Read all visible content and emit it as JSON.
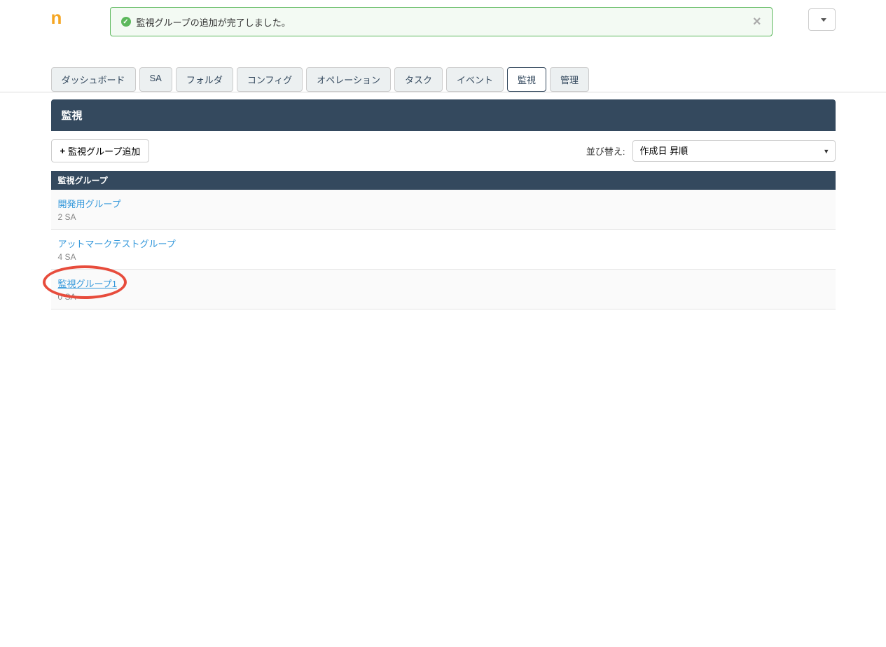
{
  "logo": "n",
  "alert": {
    "message": "監視グループの追加が完了しました。"
  },
  "tabs": [
    {
      "label": "ダッシュボード",
      "active": false
    },
    {
      "label": "SA",
      "active": false
    },
    {
      "label": "フォルダ",
      "active": false
    },
    {
      "label": "コンフィグ",
      "active": false
    },
    {
      "label": "オペレーション",
      "active": false
    },
    {
      "label": "タスク",
      "active": false
    },
    {
      "label": "イベント",
      "active": false
    },
    {
      "label": "監視",
      "active": true
    },
    {
      "label": "管理",
      "active": false
    }
  ],
  "page_title": "監視",
  "toolbar": {
    "add_button": "監視グループ追加",
    "sort_label": "並び替え:",
    "sort_value": "作成日 昇順"
  },
  "section_header": "監視グループ",
  "groups": [
    {
      "name": "開発用グループ",
      "meta": "2 SA",
      "highlighted": false
    },
    {
      "name": "アットマークテストグループ",
      "meta": "4 SA",
      "highlighted": false
    },
    {
      "name": "監視グループ1",
      "meta": "0 SA",
      "highlighted": true
    }
  ]
}
